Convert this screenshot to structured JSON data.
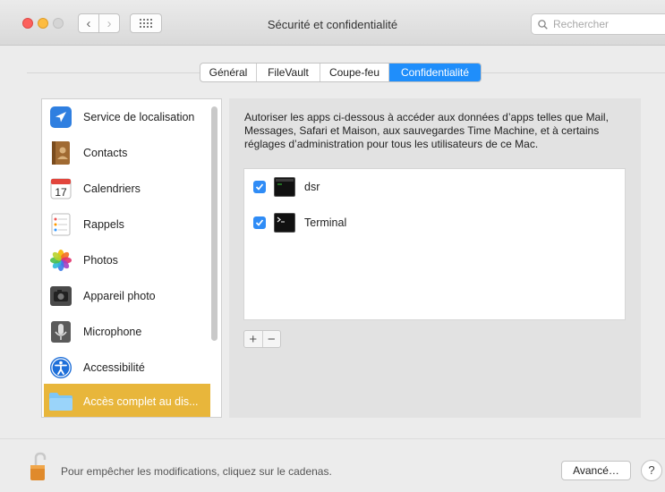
{
  "window": {
    "title": "Sécurité et confidentialité"
  },
  "toolbar": {
    "back_glyph": "‹",
    "forward_glyph": "›",
    "grid_icon": "grid-icon"
  },
  "search": {
    "placeholder": "Rechercher"
  },
  "tabs": [
    {
      "label": "Général",
      "active": false
    },
    {
      "label": "FileVault",
      "active": false
    },
    {
      "label": "Coupe-feu",
      "active": false
    },
    {
      "label": "Confidentialité",
      "active": true
    }
  ],
  "sidebar": {
    "items": [
      {
        "label": "Service de localisation",
        "icon": "location-arrow-icon"
      },
      {
        "label": "Contacts",
        "icon": "contacts-book-icon"
      },
      {
        "label": "Calendriers",
        "icon": "calendar-icon",
        "icon_text": "17"
      },
      {
        "label": "Rappels",
        "icon": "reminders-list-icon"
      },
      {
        "label": "Photos",
        "icon": "photos-flower-icon"
      },
      {
        "label": "Appareil photo",
        "icon": "camera-icon"
      },
      {
        "label": "Microphone",
        "icon": "microphone-icon"
      },
      {
        "label": "Accessibilité",
        "icon": "accessibility-icon"
      },
      {
        "label": "Accès complet au dis...",
        "icon": "folder-icon",
        "selected": true
      }
    ]
  },
  "content": {
    "description": "Autoriser les apps ci-dessous à accéder aux données d’apps telles que Mail, Messages, Safari et Maison, aux sauvegardes Time Machine, et à certains réglages d’administration pour tous les utilisateurs de ce Mac.",
    "apps": [
      {
        "name": "dsr",
        "checked": true,
        "icon": "terminal-app-icon"
      },
      {
        "name": "Terminal",
        "checked": true,
        "icon": "terminal-app-icon"
      }
    ],
    "add_label": "+",
    "remove_label": "−"
  },
  "footer": {
    "lock_text": "Pour empêcher les modifications, cliquez sur le cadenas.",
    "advanced_label": "Avancé…",
    "help_label": "?"
  },
  "colors": {
    "accent": "#1f8efb",
    "selection": "#e8b63b",
    "checkbox": "#2f8cf6"
  }
}
